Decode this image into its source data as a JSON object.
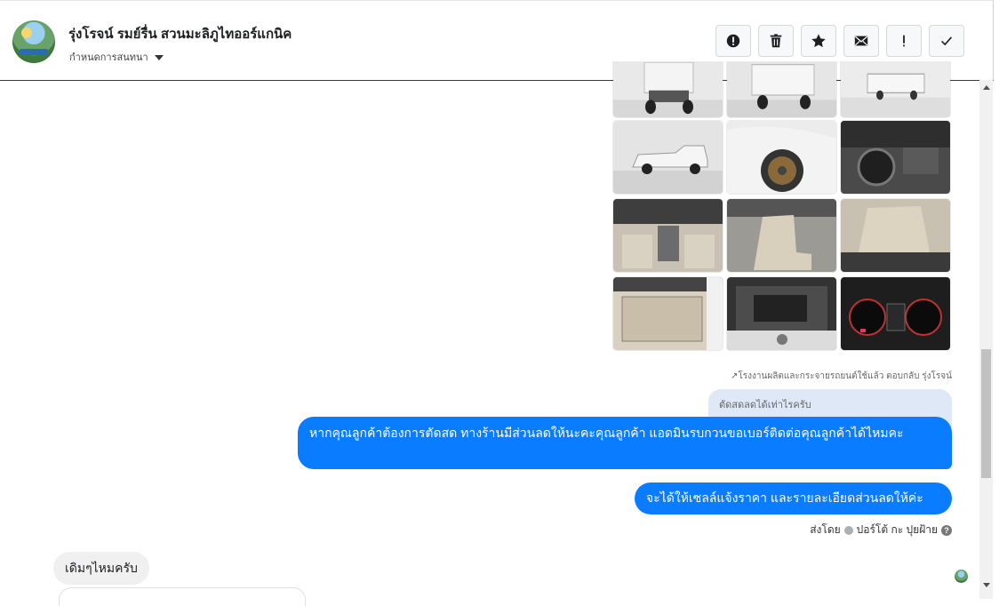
{
  "header": {
    "contact_name": "รุ่งโรจน์ รมย์รื่น สวนมะลิภูไทออร์แกนิค",
    "assign_label": "กำหนดการสนทนา",
    "actions": [
      {
        "icon": "alert-circle-icon",
        "name": "spam-button"
      },
      {
        "icon": "trash-icon",
        "name": "delete-button"
      },
      {
        "icon": "star-icon",
        "name": "star-button"
      },
      {
        "icon": "envelope-icon",
        "name": "mark-unread-button"
      },
      {
        "icon": "exclamation-icon",
        "name": "follow-up-button"
      },
      {
        "icon": "checkmark-icon",
        "name": "done-button"
      }
    ]
  },
  "photo_grid": {
    "tiles": [
      {
        "name": "car-rear-photo",
        "kind": "rear"
      },
      {
        "name": "car-rear-angle-photo",
        "kind": "rear2"
      },
      {
        "name": "car-side-far-photo",
        "kind": "sidefar"
      },
      {
        "name": "car-side-photo",
        "kind": "side"
      },
      {
        "name": "car-wheel-photo",
        "kind": "wheel"
      },
      {
        "name": "car-dashboard-photo",
        "kind": "dash"
      },
      {
        "name": "car-interior-front-photo",
        "kind": "interior"
      },
      {
        "name": "car-seat-photo",
        "kind": "seat"
      },
      {
        "name": "car-rear-seat-photo",
        "kind": "seat2"
      },
      {
        "name": "car-door-panel-photo",
        "kind": "door"
      },
      {
        "name": "car-engine-photo",
        "kind": "engine"
      },
      {
        "name": "car-gauges-photo",
        "kind": "gauge"
      }
    ]
  },
  "messages": {
    "reply_meta": "โรงงานผลิตและกระจายรถยนต์ใช้แล้ว ตอบกลับ รุ่งโรจน์",
    "quoted_text": "ตัดสดลดได้เท่าไรครับ",
    "outgoing_1": "หากคุณลูกค้าต้องการตัดสด ทางร้านมีส่วนลดให้นะคะคุณลูกค้า แอดมินรบกวนขอเบอร์ติดต่อคุณลูกค้าได้ไหมคะ",
    "outgoing_2": "จะได้ให้เซลล์แจ้งราคา และรายละเอียดส่วนลดให้ค่ะ",
    "sent_by_label": "ส่งโดย",
    "sent_by_name": "ปอร์โต้ กะ ปุยฝ้าย",
    "help_mark": "?",
    "incoming_1": "เดิมๆไหมครับ"
  },
  "colors": {
    "outgoing_bubble": "#0a7cff",
    "incoming_bubble": "#f0f0f0",
    "quoted_bg": "#dfe8f7"
  }
}
